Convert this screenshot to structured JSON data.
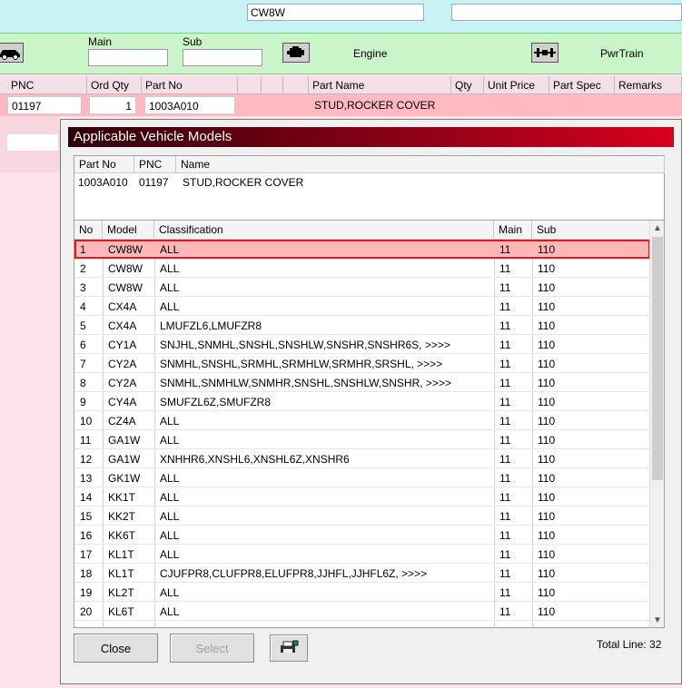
{
  "top": {
    "search_value": "CW8W",
    "second_value": ""
  },
  "group_bar": {
    "main_label": "Main",
    "sub_label": "Sub",
    "main_value": "",
    "sub_value": "",
    "engine_label": "Engine",
    "pwrtrain_label": "PwrTrain",
    "icons": [
      "car-icon",
      "engine-icon",
      "powertrain-icon"
    ]
  },
  "parts_grid": {
    "headers": {
      "pnc": "PNC",
      "ord_qty": "Ord Qty",
      "part_no": "Part No",
      "part_name": "Part Name",
      "qty": "Qty",
      "unit_price": "Unit Price",
      "part_spec": "Part Spec",
      "remarks": "Remarks"
    },
    "row": {
      "pnc": "01197",
      "ord_qty": "1",
      "part_no": "1003A010",
      "part_name": "STUD,ROCKER COVER"
    }
  },
  "dialog": {
    "title": "Applicable Vehicle Models",
    "info_headers": {
      "part_no": "Part No",
      "pnc": "PNC",
      "name": "Name"
    },
    "info_values": {
      "part_no": "1003A010",
      "pnc": "01197",
      "name": "STUD,ROCKER COVER"
    },
    "list_headers": {
      "no": "No",
      "model": "Model",
      "classification": "Classification",
      "main": "Main",
      "sub": "Sub"
    },
    "rows": [
      {
        "no": "1",
        "model": "CW8W",
        "classification": "ALL",
        "main": "11",
        "sub": "110"
      },
      {
        "no": "2",
        "model": "CW8W",
        "classification": "ALL",
        "main": "11",
        "sub": "110"
      },
      {
        "no": "3",
        "model": "CW8W",
        "classification": "ALL",
        "main": "11",
        "sub": "110"
      },
      {
        "no": "4",
        "model": "CX4A",
        "classification": "ALL",
        "main": "11",
        "sub": "110"
      },
      {
        "no": "5",
        "model": "CX4A",
        "classification": "LMUFZL6,LMUFZR8",
        "main": "11",
        "sub": "110"
      },
      {
        "no": "6",
        "model": "CY1A",
        "classification": "SNJHL,SNMHL,SNSHL,SNSHLW,SNSHR,SNSHR6S,  >>>>",
        "main": "11",
        "sub": "110"
      },
      {
        "no": "7",
        "model": "CY2A",
        "classification": "SNMHL,SNSHL,SRMHL,SRMHLW,SRMHR,SRSHL,  >>>>",
        "main": "11",
        "sub": "110"
      },
      {
        "no": "8",
        "model": "CY2A",
        "classification": "SNMHL,SNMHLW,SNMHR,SNSHL,SNSHLW,SNSHR,  >>>>",
        "main": "11",
        "sub": "110"
      },
      {
        "no": "9",
        "model": "CY4A",
        "classification": "SMUFZL6Z,SMUFZR8",
        "main": "11",
        "sub": "110"
      },
      {
        "no": "10",
        "model": "CZ4A",
        "classification": "ALL",
        "main": "11",
        "sub": "110"
      },
      {
        "no": "11",
        "model": "GA1W",
        "classification": "ALL",
        "main": "11",
        "sub": "110"
      },
      {
        "no": "12",
        "model": "GA1W",
        "classification": "XNHHR6,XNSHL6,XNSHL6Z,XNSHR6",
        "main": "11",
        "sub": "110"
      },
      {
        "no": "13",
        "model": "GK1W",
        "classification": "ALL",
        "main": "11",
        "sub": "110"
      },
      {
        "no": "14",
        "model": "KK1T",
        "classification": "ALL",
        "main": "11",
        "sub": "110"
      },
      {
        "no": "15",
        "model": "KK2T",
        "classification": "ALL",
        "main": "11",
        "sub": "110"
      },
      {
        "no": "16",
        "model": "KK6T",
        "classification": "ALL",
        "main": "11",
        "sub": "110"
      },
      {
        "no": "17",
        "model": "KL1T",
        "classification": "ALL",
        "main": "11",
        "sub": "110"
      },
      {
        "no": "18",
        "model": "KL1T",
        "classification": "CJUFPR8,CLUFPR8,ELUFPR8,JJHFL,JJHFL6Z,  >>>>",
        "main": "11",
        "sub": "110"
      },
      {
        "no": "19",
        "model": "KL2T",
        "classification": "ALL",
        "main": "11",
        "sub": "110"
      },
      {
        "no": "20",
        "model": "KL6T",
        "classification": "ALL",
        "main": "11",
        "sub": "110"
      }
    ],
    "buttons": {
      "close": "Close",
      "select": "Select"
    },
    "total_line": "Total Line: 32"
  }
}
